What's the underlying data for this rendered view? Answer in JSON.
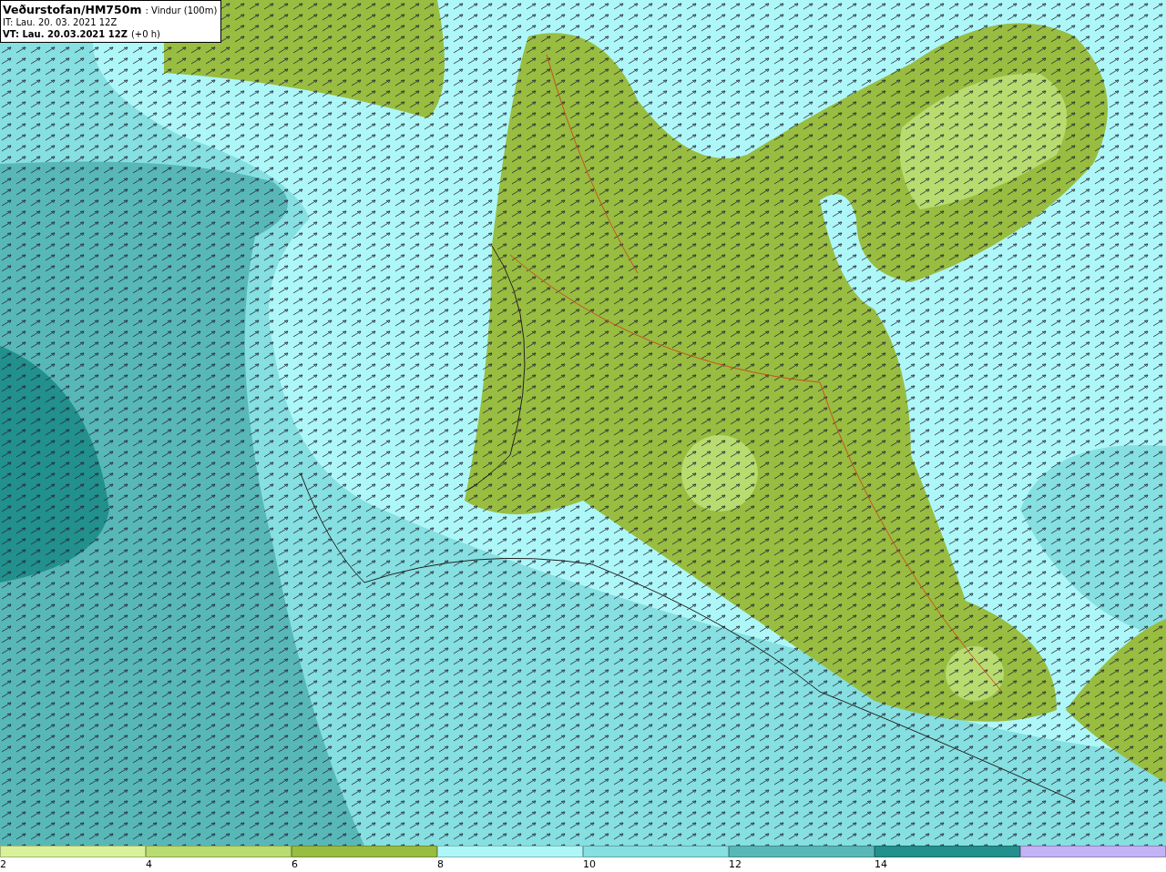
{
  "info_box": {
    "source": "Veðurstofan/HM750m",
    "parameter": ": Vindur (100m)",
    "initial_time": "IT: Lau. 20. 03. 2021 12Z",
    "valid_time": "VT: Lau. 20.03.2021 12Z",
    "lead_time": "(+0 h)"
  },
  "legend": [
    {
      "color": "#d9f29a",
      "label": "2"
    },
    {
      "color": "#b8dc70",
      "label": "4"
    },
    {
      "color": "#98bd40",
      "label": "6"
    },
    {
      "color": "#aef7f9",
      "label": "8"
    },
    {
      "color": "#86dfe0",
      "label": "10"
    },
    {
      "color": "#58b8b8",
      "label": "12"
    },
    {
      "color": "#22908c",
      "label": "14"
    },
    {
      "color": "#c4b2f7"
    }
  ]
}
